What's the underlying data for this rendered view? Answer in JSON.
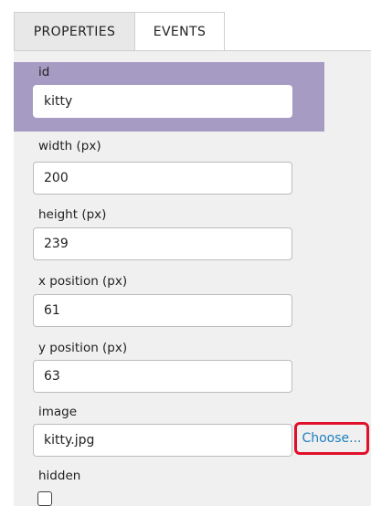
{
  "tabs": {
    "properties": "PROPERTIES",
    "events": "EVENTS"
  },
  "fields": {
    "id": {
      "label": "id",
      "value": "kitty"
    },
    "width": {
      "label": "width (px)",
      "value": "200"
    },
    "height": {
      "label": "height (px)",
      "value": "239"
    },
    "x": {
      "label": "x position (px)",
      "value": "61"
    },
    "y": {
      "label": "y position (px)",
      "value": "63"
    },
    "image": {
      "label": "image",
      "value": "kitty.jpg",
      "button": "Choose..."
    },
    "hidden": {
      "label": "hidden",
      "checked": false
    }
  },
  "colors": {
    "id_highlight": "#a69bc3",
    "panel_bg": "#f0f0f0",
    "choose_link": "#1e7fc0",
    "annotation_box": "#e0102a"
  }
}
